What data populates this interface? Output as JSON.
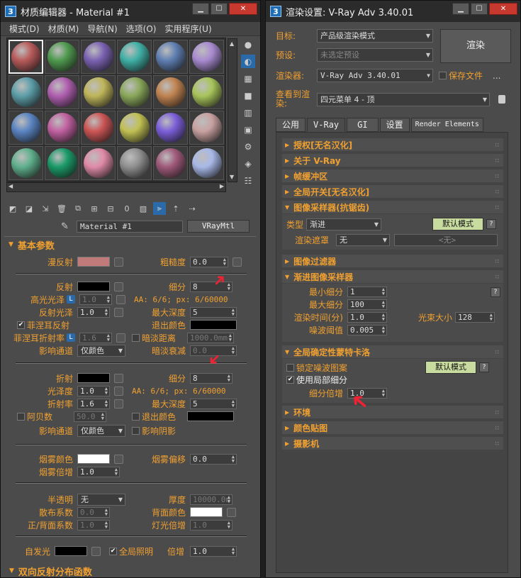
{
  "left_window": {
    "title": "材质编辑器 - Material #1",
    "logo": "3",
    "menu": [
      "模式(D)",
      "材质(M)",
      "导航(N)",
      "选项(O)",
      "实用程序(U)"
    ],
    "spheres": [
      "#b85a5a",
      "#4f9a4f",
      "#7b62b3",
      "#3fb0a6",
      "#5f7fb2",
      "#a88ad0",
      "#5c9ea8",
      "#b05fb0",
      "#bfb55a",
      "#8aa85a",
      "#c08350",
      "#a8c55a",
      "#5a84c2",
      "#c060a0",
      "#cc5555",
      "#c0c052",
      "#7a5ed8",
      "#c8a0a0",
      "#5fb08c",
      "#1a9a68",
      "#e08aa8",
      "#909090",
      "#a05a7a",
      "#a8b8e8"
    ],
    "material_name": "Material #1",
    "material_type": "VRayMtl",
    "basic_params": {
      "header": "基本参数",
      "diffuse": {
        "label": "漫反射",
        "color": "#c07a7a"
      },
      "roughness": {
        "label": "粗糙度",
        "value": "0.0"
      },
      "reflect": {
        "label": "反射",
        "color": "#000000"
      },
      "subdivs": {
        "label": "细分",
        "value": "8"
      },
      "hilight_gloss": {
        "label": "高光光泽",
        "lock": "L",
        "value": "1.0"
      },
      "aa_info": "AA: 6/6; px: 6/60000",
      "refl_gloss": {
        "label": "反射光泽",
        "value": "1.0"
      },
      "max_depth": {
        "label": "最大深度",
        "value": "5"
      },
      "fresnel": {
        "label": "菲涅耳反射",
        "checked": true
      },
      "exit_color": {
        "label": "退出颜色",
        "color": "#000000"
      },
      "fresnel_ior": {
        "label": "菲涅耳折射率",
        "lock": "L",
        "value": "1.6"
      },
      "dim_distance": {
        "label": "暗淡距离",
        "value": "1000.0mm"
      },
      "affect_channels": {
        "label": "影响通道",
        "value": "仅颜色"
      },
      "dim_falloff": {
        "label": "暗淡衰减",
        "value": "0.0"
      },
      "refract": {
        "label": "折射",
        "color": "#000000"
      },
      "refr_subdivs": {
        "label": "细分",
        "value": "8"
      },
      "refr_gloss": {
        "label": "光泽度",
        "value": "1.0"
      },
      "refr_aa_info": "AA: 6/6; px: 6/60000",
      "ior": {
        "label": "折射率",
        "value": "1.6"
      },
      "refr_max_depth": {
        "label": "最大深度",
        "value": "5"
      },
      "abbe": {
        "label": "阿贝数",
        "value": "50.0"
      },
      "refr_exit_color": {
        "label": "退出颜色",
        "color": "#000000"
      },
      "refr_affect_channels": {
        "label": "影响通道",
        "value": "仅颜色"
      },
      "affect_shadows": {
        "label": "影响阴影"
      },
      "fog_color": {
        "label": "烟雾颜色",
        "color": "#ffffff"
      },
      "fog_bias": {
        "label": "烟雾偏移",
        "value": "0.0"
      },
      "fog_mult": {
        "label": "烟雾倍增",
        "value": "1.0"
      },
      "translucency": {
        "label": "半透明",
        "value": "无"
      },
      "thickness": {
        "label": "厚度",
        "value": "10000.0m"
      },
      "scatter_coeff": {
        "label": "散布系数",
        "value": "0.0"
      },
      "back_color": {
        "label": "背面颜色",
        "color": "#ffffff"
      },
      "fwd_bck": {
        "label": "正/背面系数",
        "value": "1.0"
      },
      "light_mult": {
        "label": "灯光倍增",
        "value": "1.0"
      },
      "self_illum": {
        "label": "自发光",
        "color": "#000000"
      },
      "gi": {
        "label": "全局照明",
        "checked": true
      },
      "multiplier": {
        "label": "倍增",
        "value": "1.0"
      }
    },
    "brdf_header": "双向反射分布函数"
  },
  "right_window": {
    "title": "渲染设置: V-Ray Adv 3.40.01",
    "logo": "3",
    "target": {
      "label": "目标:",
      "value": "产品级渲染模式"
    },
    "preset": {
      "label": "预设:",
      "value": "未选定预设"
    },
    "renderer": {
      "label": "渲染器:",
      "value": "V-Ray Adv 3.40.01"
    },
    "save_file": "保存文件",
    "ellipsis": "...",
    "view": {
      "label": "查看到渲染:",
      "value": "四元菜单 4 - 顶"
    },
    "render_button": "渲染",
    "tabs": [
      "公用",
      "V-Ray",
      "GI",
      "设置",
      "Render Elements"
    ],
    "rollouts": {
      "auth": "授权[无名汉化]",
      "about": "关于 V-Ray",
      "framebuf": "帧缓冲区",
      "global_switch": "全局开关[无名汉化]",
      "img_sampler": "图像采样器(抗锯齿)",
      "img_filter": "图像过滤器",
      "prog_sampler": "渐进图像采样器",
      "global_dmc": "全局确定性蒙特卡洛",
      "env": "环境",
      "color_map": "颜色贴图",
      "camera": "摄影机"
    },
    "img_sampler": {
      "type_label": "类型",
      "type_value": "渐进",
      "default_mode": "默认模式",
      "help": "?",
      "mask_label": "渲染遮罩",
      "mask_value": "无",
      "mask_field": "<无>"
    },
    "prog_sampler": {
      "min_subdivs": {
        "label": "最小细分",
        "value": "1"
      },
      "max_subdivs": {
        "label": "最大细分",
        "value": "100"
      },
      "render_time": {
        "label": "渲染时间(分)",
        "value": "1.0"
      },
      "bundle_size": {
        "label": "光束大小",
        "value": "128"
      },
      "noise_threshold": {
        "label": "噪波阈值",
        "value": "0.005"
      },
      "help": "?"
    },
    "global_dmc": {
      "lock_noise": "锁定噪波图案",
      "use_local": "使用局部细分",
      "subdivs_mult": {
        "label": "细分倍增",
        "value": "1.0"
      },
      "default_mode": "默认模式",
      "help": "?"
    }
  }
}
